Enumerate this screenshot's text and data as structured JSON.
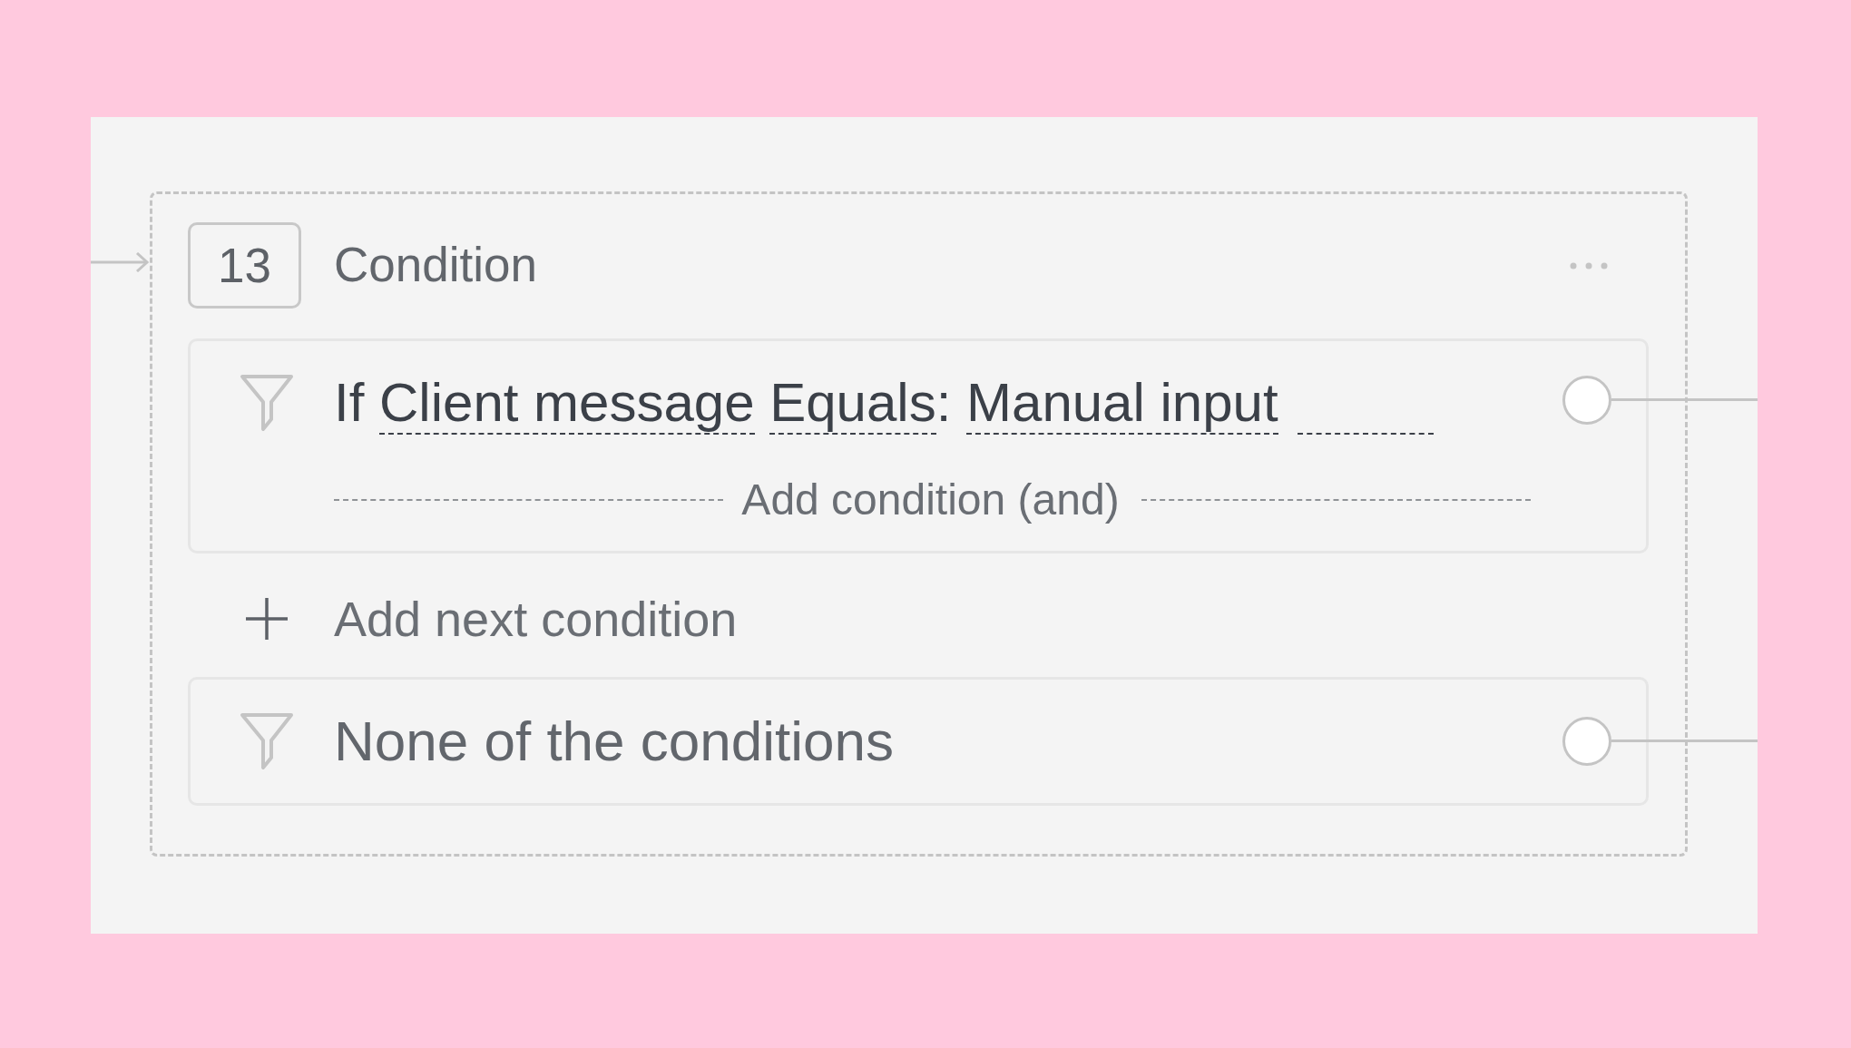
{
  "node": {
    "number": "13",
    "title": "Condition",
    "conditions": [
      {
        "keyword": "If",
        "subject": "Client message",
        "operator": "Equals",
        "separator": ":",
        "value": "Manual input",
        "add_and": "Add condition (and)"
      }
    ],
    "add_next": "Add next condition",
    "fallback": {
      "label": "None of the conditions"
    }
  }
}
